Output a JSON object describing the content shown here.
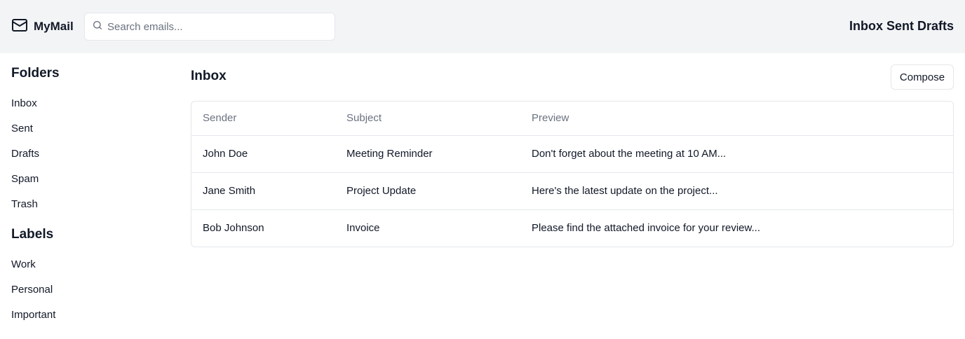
{
  "app": {
    "name": "MyMail",
    "logo_icon": "mail-icon"
  },
  "search": {
    "placeholder": "Search emails...",
    "value": "",
    "icon": "search-icon"
  },
  "topnav": {
    "items": [
      "Inbox",
      "Sent",
      "Drafts"
    ]
  },
  "sidebar": {
    "folders_heading": "Folders",
    "folders": [
      "Inbox",
      "Sent",
      "Drafts",
      "Spam",
      "Trash"
    ],
    "labels_heading": "Labels",
    "labels": [
      "Work",
      "Personal",
      "Important"
    ]
  },
  "main": {
    "title": "Inbox",
    "compose_label": "Compose",
    "columns": [
      "Sender",
      "Subject",
      "Preview"
    ],
    "emails": [
      {
        "sender": "John Doe",
        "subject": "Meeting Reminder",
        "preview": "Don't forget about the meeting at 10 AM..."
      },
      {
        "sender": "Jane Smith",
        "subject": "Project Update",
        "preview": "Here's the latest update on the project..."
      },
      {
        "sender": "Bob Johnson",
        "subject": "Invoice",
        "preview": "Please find the attached invoice for your review..."
      }
    ]
  },
  "colors": {
    "topbar_bg": "#f3f4f6",
    "border": "#e5e7eb",
    "muted_text": "#6b7280",
    "text": "#111827"
  }
}
